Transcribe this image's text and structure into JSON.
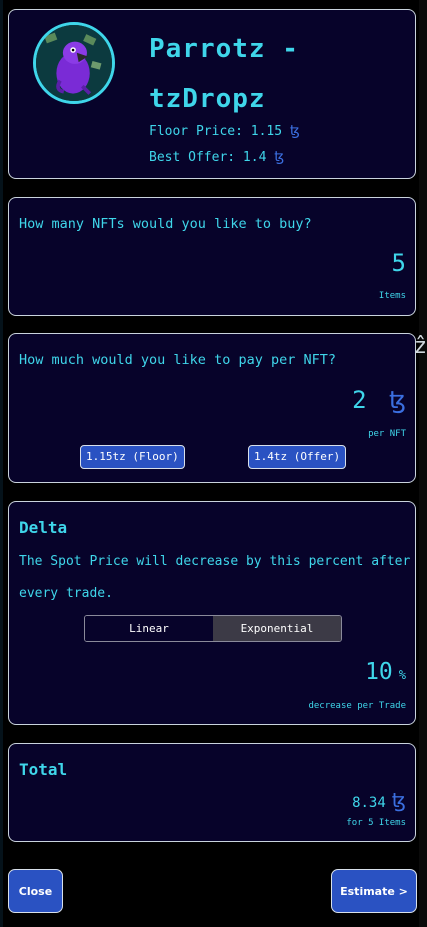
{
  "collection": {
    "title": "Parrotz - tzDropz",
    "floor_label": "Floor Price: 1.15",
    "offer_label": "Best Offer: 1.4",
    "currency_symbol": "ꜩ"
  },
  "quantity": {
    "question": "How many NFTs would you like to buy?",
    "value": "5",
    "unit": "Items"
  },
  "price": {
    "question": "How much would you like to pay per NFT?",
    "value": "2",
    "unit": "per NFT",
    "preset_floor": "1.15tz (Floor)",
    "preset_offer": "1.4tz (Offer)"
  },
  "delta": {
    "title": "Delta",
    "description": "The Spot Price will decrease by this percent after every trade.",
    "mode_options": [
      "Linear",
      "Exponential"
    ],
    "selected_mode": "Exponential",
    "value": "10",
    "sign": "%",
    "unit": "decrease per Trade"
  },
  "total": {
    "title": "Total",
    "value": "8.34",
    "note": "for 5 Items"
  },
  "actions": {
    "close_label": "Close",
    "estimate_label": "Estimate >"
  },
  "colors": {
    "accent": "#3fd6ea",
    "card_bg": "#07032a",
    "button_bg": "#2a52c2",
    "tez_blue": "#3b6fe0"
  }
}
